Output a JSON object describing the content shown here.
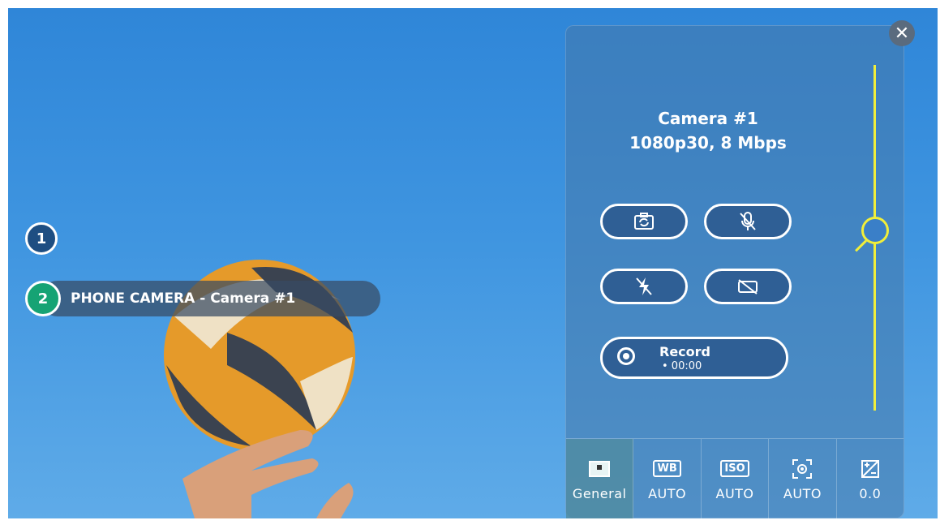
{
  "sources": [
    {
      "number": "1"
    },
    {
      "number": "2",
      "label": "PHONE CAMERA - Camera #1"
    }
  ],
  "panel": {
    "close_symbol": "✕",
    "camera_title": "Camera #1",
    "camera_specs": "1080p30, 8 Mbps",
    "controls": {
      "switch_camera_icon": "camera-switch-icon",
      "mute_mic_icon": "mic-off-icon",
      "flash_off_icon": "flash-off-icon",
      "video_off_icon": "video-off-icon"
    },
    "record": {
      "label": "Record",
      "time": "• 00:00"
    },
    "tabs": [
      {
        "icon": "image-settings-icon",
        "value": "General"
      },
      {
        "icon": "white-balance-icon",
        "badge": "WB",
        "value": "AUTO"
      },
      {
        "icon": "iso-icon",
        "badge": "ISO",
        "value": "AUTO"
      },
      {
        "icon": "focus-icon",
        "value": "AUTO"
      },
      {
        "icon": "exposure-icon",
        "value": "0.0"
      }
    ]
  },
  "colors": {
    "accent_yellow": "#f1ee3a",
    "source_green": "#16a374",
    "source_blue": "#1e4e82"
  }
}
